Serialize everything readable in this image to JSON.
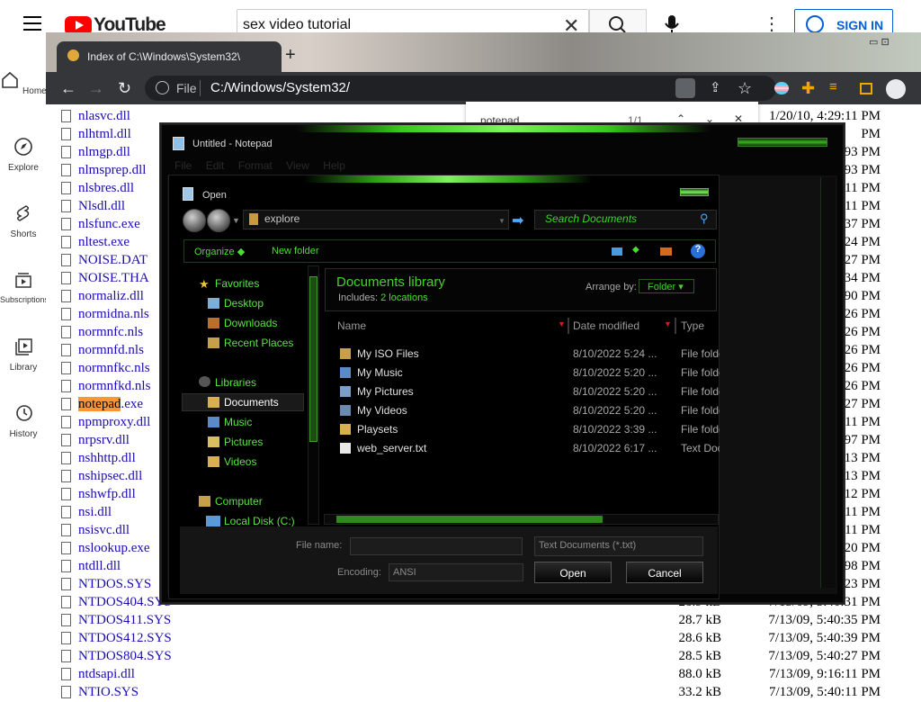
{
  "youtube": {
    "logo_text": "YouTube",
    "search_value": "sex video tutorial",
    "signin_label": "SIGN IN",
    "nav": [
      {
        "label": "Home"
      },
      {
        "label": "Explore"
      },
      {
        "label": "Shorts"
      },
      {
        "label": "Subscriptions"
      },
      {
        "label": "Library"
      },
      {
        "label": "History"
      }
    ],
    "brand_color": "#ff0000",
    "link_color": "#065fd4"
  },
  "browser": {
    "tab_title": "Index of C:\\Windows\\System32\\",
    "scheme": "File",
    "url": "C:/Windows/System32/",
    "find_query": "notepad",
    "find_count": "1/1"
  },
  "listing": {
    "files": [
      {
        "name": "nlasvc.dll",
        "size": "",
        "date": "1/20/10, 4:29:11 PM"
      },
      {
        "name": "nlhtml.dll",
        "size": "",
        "date": "PM"
      },
      {
        "name": "nlmgp.dll",
        "size": "",
        "date": "93 PM"
      },
      {
        "name": "nlmsprep.dll",
        "size": "",
        "date": "93 PM"
      },
      {
        "name": "nlsbres.dll",
        "size": "",
        "date": "11 PM"
      },
      {
        "name": "Nlsdl.dll",
        "size": "",
        "date": "11 PM"
      },
      {
        "name": "nlsfunc.exe",
        "size": "",
        "date": "37 PM"
      },
      {
        "name": "nltest.exe",
        "size": "",
        "date": "24 PM"
      },
      {
        "name": "NOISE.DAT",
        "size": "",
        "date": "27 PM"
      },
      {
        "name": "NOISE.THA",
        "size": "",
        "date": "34 PM"
      },
      {
        "name": "normaliz.dll",
        "size": "",
        "date": "90 PM"
      },
      {
        "name": "normidna.nls",
        "size": "",
        "date": "26 PM"
      },
      {
        "name": "normnfc.nls",
        "size": "",
        "date": "26 PM"
      },
      {
        "name": "normnfd.nls",
        "size": "",
        "date": "26 PM"
      },
      {
        "name": "normnfkc.nls",
        "size": "",
        "date": "26 PM"
      },
      {
        "name": "normnfkd.nls",
        "size": "",
        "date": "26 PM"
      },
      {
        "name_highlight": "notepad",
        "name_rest": ".exe",
        "size": "",
        "date": "27 PM"
      },
      {
        "name": "npmproxy.dll",
        "size": "",
        "date": "11 PM"
      },
      {
        "name": "nrpsrv.dll",
        "size": "",
        "date": "97 PM"
      },
      {
        "name": "nshhttp.dll",
        "size": "",
        "date": "13 PM"
      },
      {
        "name": "nshipsec.dll",
        "size": "",
        "date": "13 PM"
      },
      {
        "name": "nshwfp.dll",
        "size": "",
        "date": "12 PM"
      },
      {
        "name": "nsi.dll",
        "size": "",
        "date": "11 PM"
      },
      {
        "name": "nsisvc.dll",
        "size": "",
        "date": "11 PM"
      },
      {
        "name": "nslookup.exe",
        "size": "",
        "date": "20 PM"
      },
      {
        "name": "ntdll.dll",
        "size": "",
        "date": "98 PM"
      },
      {
        "name": "NTDOS.SYS",
        "size": "",
        "date": "23 PM"
      },
      {
        "name": "NTDOS404.SYS",
        "size": "28.9 kB",
        "date": "7/13/09, 5:40:31 PM"
      },
      {
        "name": "NTDOS411.SYS",
        "size": "28.7 kB",
        "date": "7/13/09, 5:40:35 PM"
      },
      {
        "name": "NTDOS412.SYS",
        "size": "28.6 kB",
        "date": "7/13/09, 5:40:39 PM"
      },
      {
        "name": "NTDOS804.SYS",
        "size": "28.5 kB",
        "date": "7/13/09, 5:40:27 PM"
      },
      {
        "name": "ntdsapi.dll",
        "size": "88.0 kB",
        "date": "7/13/09, 9:16:11 PM"
      },
      {
        "name": "NTIO.SYS",
        "size": "33.2 kB",
        "date": "7/13/09, 5:40:11 PM"
      }
    ]
  },
  "notepad": {
    "title": "Untitled - Notepad",
    "menu": [
      "File",
      "Edit",
      "Format",
      "View",
      "Help"
    ]
  },
  "open_dialog": {
    "title": "Open",
    "address": "explore",
    "search_placeholder": "Search Documents",
    "organize": "Organize",
    "new_folder": "New folder",
    "nav_tree": {
      "favorites": "Favorites",
      "desktop": "Desktop",
      "downloads": "Downloads",
      "recent": "Recent Places",
      "libraries": "Libraries",
      "documents": "Documents",
      "music": "Music",
      "pictures": "Pictures",
      "videos": "Videos",
      "computer": "Computer",
      "local_disk": "Local Disk (C:)"
    },
    "library_title": "Documents library",
    "includes_label": "Includes:",
    "includes_value": "2 locations",
    "arrange_label": "Arrange by:",
    "arrange_value": "Folder",
    "columns": {
      "name": "Name",
      "date": "Date modified",
      "type": "Type"
    },
    "items": [
      {
        "name": "My ISO Files",
        "date": "8/10/2022 5:24 ...",
        "type": "File folder"
      },
      {
        "name": "My Music",
        "date": "8/10/2022 5:20 ...",
        "type": "File folder"
      },
      {
        "name": "My Pictures",
        "date": "8/10/2022 5:20 ...",
        "type": "File folder"
      },
      {
        "name": "My Videos",
        "date": "8/10/2022 5:20 ...",
        "type": "File folder"
      },
      {
        "name": "Playsets",
        "date": "8/10/2022 3:39 ...",
        "type": "File folder"
      },
      {
        "name": "web_server.txt",
        "date": "8/10/2022 6:17 ...",
        "type": "Text Document"
      }
    ],
    "file_name_label": "File name:",
    "file_name_value": "",
    "filter": "Text Documents (*.txt)",
    "encoding_label": "Encoding:",
    "encoding_value": "ANSI",
    "open_btn": "Open",
    "cancel_btn": "Cancel",
    "accent_color": "#48e030"
  }
}
